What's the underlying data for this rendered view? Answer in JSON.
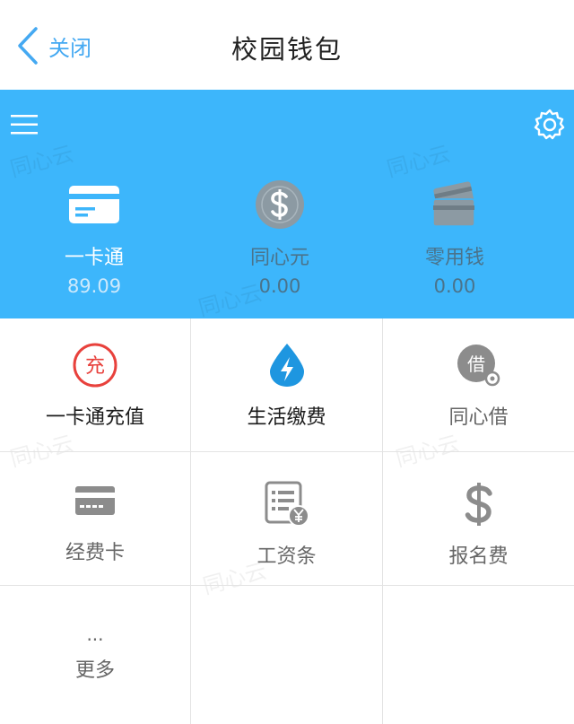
{
  "nav": {
    "back_label": "关闭",
    "title": "校园钱包"
  },
  "header": {
    "bg_color": "#3db6fb",
    "menu_icon": "hamburger-menu-icon",
    "settings_icon": "gear-icon",
    "wallets": [
      {
        "name": "一卡通",
        "balance": "89.09",
        "icon": "card-icon",
        "active": true
      },
      {
        "name": "同心元",
        "balance": "0.00",
        "icon": "dollar-coin-icon",
        "active": false
      },
      {
        "name": "零用钱",
        "balance": "0.00",
        "icon": "cards-stack-icon",
        "active": false
      }
    ]
  },
  "grid": {
    "items": [
      {
        "label": "一卡通充值",
        "icon": "recharge-icon",
        "icon_text": "充",
        "color": "#e8413c"
      },
      {
        "label": "生活缴费",
        "icon": "water-drop-bolt-icon",
        "color": "#1e96e0"
      },
      {
        "label": "同心借",
        "icon": "borrow-icon",
        "icon_text": "借",
        "color": "#8c8c8c"
      },
      {
        "label": "经费卡",
        "icon": "credit-card-icon",
        "color": "#8c8c8c"
      },
      {
        "label": "工资条",
        "icon": "payslip-icon",
        "color": "#8c8c8c"
      },
      {
        "label": "报名费",
        "icon": "dollar-icon",
        "color": "#8c8c8c"
      },
      {
        "label": "更多",
        "icon": "more-dots-icon",
        "icon_text": "...",
        "color": "#666666"
      }
    ]
  },
  "watermark": "同心云"
}
